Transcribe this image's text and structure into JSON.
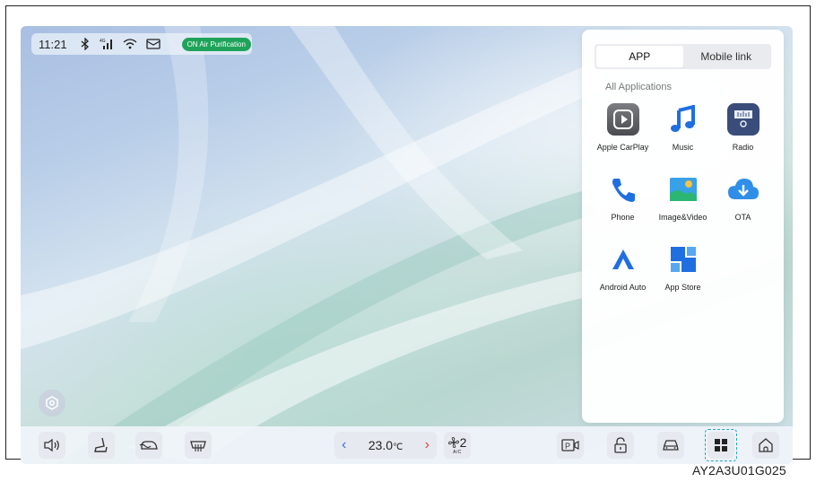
{
  "status_bar": {
    "time": "11:21",
    "badge": "ON Air Purification",
    "icons": [
      "bluetooth-icon",
      "cellular-signal-icon",
      "wifi-icon",
      "message-icon"
    ]
  },
  "app_panel": {
    "tabs": [
      {
        "label": "APP",
        "active": true
      },
      {
        "label": "Mobile link",
        "active": false
      }
    ],
    "section_title": "All Applications",
    "apps": [
      {
        "label": "Apple CarPlay",
        "icon": "carplay-icon"
      },
      {
        "label": "Music",
        "icon": "music-note-icon"
      },
      {
        "label": "Radio",
        "icon": "radio-icon"
      },
      {
        "label": "Phone",
        "icon": "phone-handset-icon"
      },
      {
        "label": "Image&Video",
        "icon": "image-gallery-icon"
      },
      {
        "label": "OTA",
        "icon": "cloud-download-icon"
      },
      {
        "label": "Android Auto",
        "icon": "android-auto-icon"
      },
      {
        "label": "App Store",
        "icon": "app-store-icon"
      }
    ]
  },
  "dock": {
    "left_buttons": [
      "volume-icon",
      "seat-icon",
      "car-wash-icon",
      "rear-defrost-icon"
    ],
    "temperature": "23.0",
    "temperature_unit": "℃",
    "fan_level": "2",
    "fan_mode": "A/C",
    "right_buttons": [
      "parking-camera-icon",
      "lock-icon",
      "car-icon",
      "apps-grid-icon",
      "home-icon"
    ]
  },
  "caption": "AY2A3U01G025",
  "colors": {
    "badge": "#1fa35a",
    "accent_blue": "#1f6fe0",
    "arrow_left": "#3a6fd8",
    "arrow_right": "#e0413a",
    "selection_dash": "#29a6b8"
  }
}
